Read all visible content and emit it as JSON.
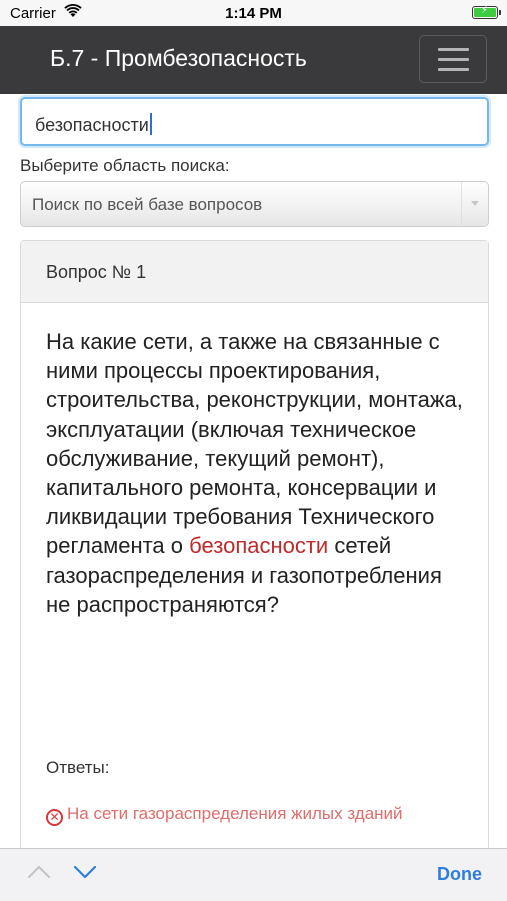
{
  "status_bar": {
    "carrier": "Carrier",
    "time": "1:14 PM"
  },
  "navbar": {
    "title": "Б.7 - Промбезопасность"
  },
  "search": {
    "value": "безопасности"
  },
  "scope": {
    "label": "Выберите область поиска:",
    "selected": "Поиск по всей базе вопросов"
  },
  "question": {
    "number": "Вопрос № 1",
    "text_before": "На какие сети, а также на связанные с ними процессы проектирования, строительства, реконструкции, монтажа, эксплуатации (включая техническое обслуживание, текущий ремонт), капитального ремонта, консервации и ликвидации требования Технического регламента о",
    "highlight": "безопасности",
    "text_after": " сетей газораспределения и газопотребления не распространяются?",
    "answers_label": "Ответы:",
    "answers": [
      {
        "text": "На сети газораспределения жилых зданий",
        "icon": "x-circle-icon",
        "color": "#d9383a"
      }
    ]
  },
  "accessory": {
    "done_label": "Done"
  },
  "colors": {
    "navbar": "#3a3a3c",
    "highlight": "#c0292b",
    "accent": "#2f7ddc"
  }
}
